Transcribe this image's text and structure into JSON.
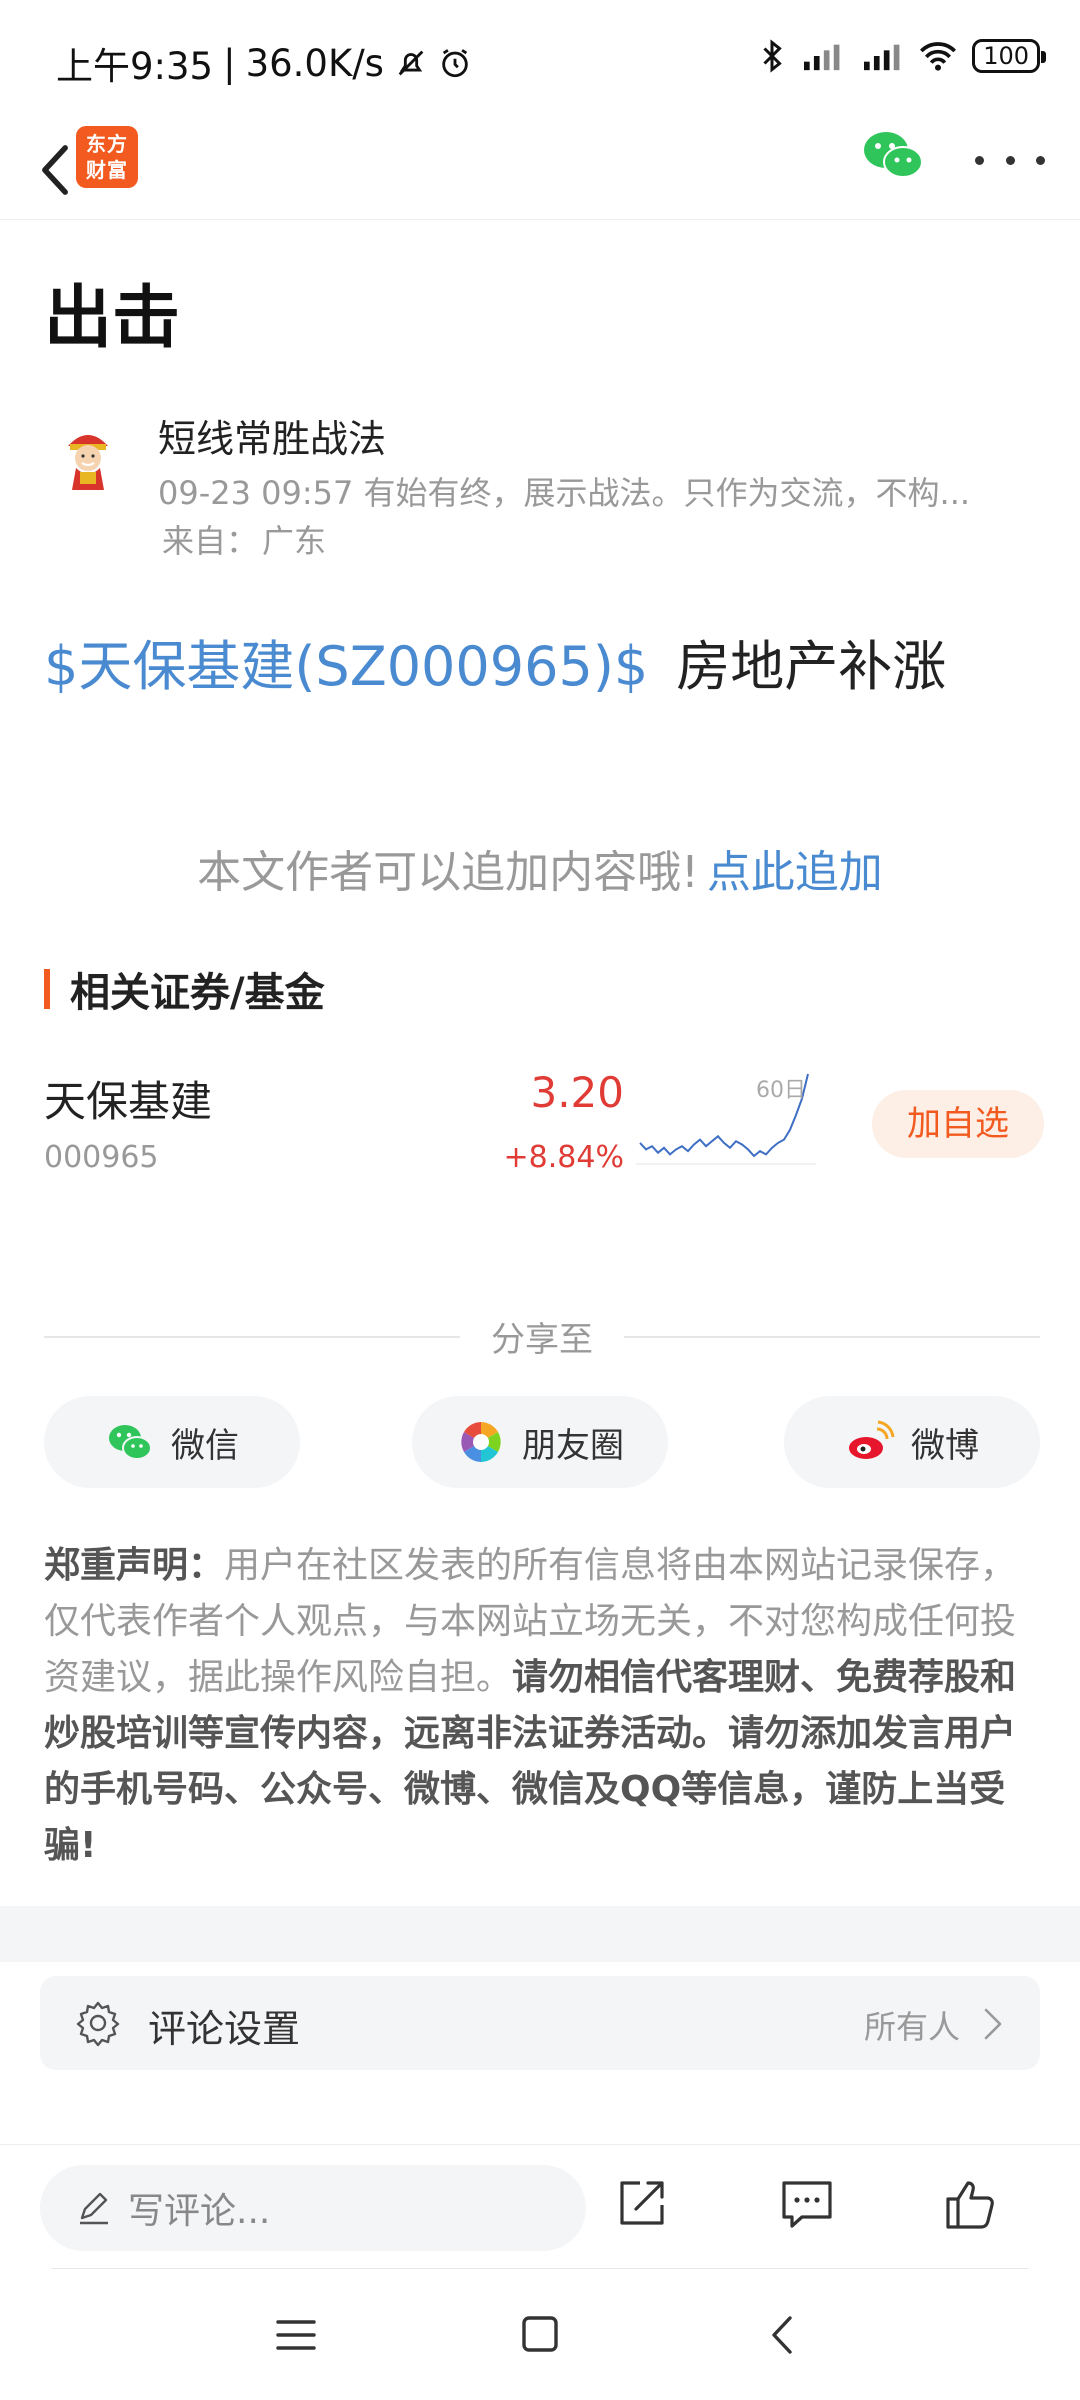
{
  "status_bar": {
    "time": "上午9:35",
    "separator": "|",
    "speed": "36.0K/s",
    "battery": "100",
    "icons": [
      "mute-icon",
      "alarm-icon",
      "bluetooth-icon",
      "signal-icon",
      "signal-icon",
      "wifi-icon",
      "battery-icon"
    ]
  },
  "app_bar": {
    "logo_line1": "东方",
    "logo_line2": "财富"
  },
  "article": {
    "title": "出击",
    "author_name": "短线常胜战法",
    "author_meta": "09-23 09:57 有始有终，展示战法。只作为交流，不构...",
    "location_label": "来自：",
    "location_value": "广东",
    "stock_link": "$天保基建(SZ000965)$",
    "content_text": "房地产补涨",
    "append_prompt": "本文作者可以追加内容哦!",
    "append_link": "点此追加"
  },
  "related": {
    "section_title": "相关证券/基金",
    "stock": {
      "name": "天保基建",
      "code": "000965",
      "price": "3.20",
      "change": "+8.84%",
      "spark_label": "60日",
      "add_button": "加自选"
    }
  },
  "share": {
    "label": "分享至",
    "wechat": "微信",
    "moments": "朋友圈",
    "weibo": "微博"
  },
  "disclaimer": {
    "lead": "郑重声明：",
    "normal": "用户在社区发表的所有信息将由本网站记录保存，仅代表作者个人观点，与本网站立场无关，不对您构成任何投资建议，据此操作风险自担。",
    "bold": "请勿相信代客理财、免费荐股和炒股培训等宣传内容，远离非法证券活动。请勿添加发言用户的手机号码、公众号、微博、微信及QQ等信息，谨防上当受骗!"
  },
  "comment_settings": {
    "label": "评论设置",
    "value": "所有人"
  },
  "bottom_bar": {
    "comment_placeholder": "写评论..."
  },
  "colors": {
    "accent": "#f25a1f",
    "link": "#4a8ad0",
    "up": "#e03b35"
  },
  "chart_data": {
    "type": "line",
    "title": "60日",
    "series": [
      {
        "values": [
          2.78,
          2.74,
          2.76,
          2.72,
          2.75,
          2.71,
          2.74,
          2.76,
          2.73,
          2.77,
          2.8,
          2.76,
          2.79,
          2.82,
          2.78,
          2.75,
          2.79,
          2.77,
          2.74,
          2.7,
          2.73,
          2.71,
          2.75,
          2.78,
          2.8,
          2.86,
          2.95,
          3.05,
          3.2
        ]
      }
    ]
  }
}
